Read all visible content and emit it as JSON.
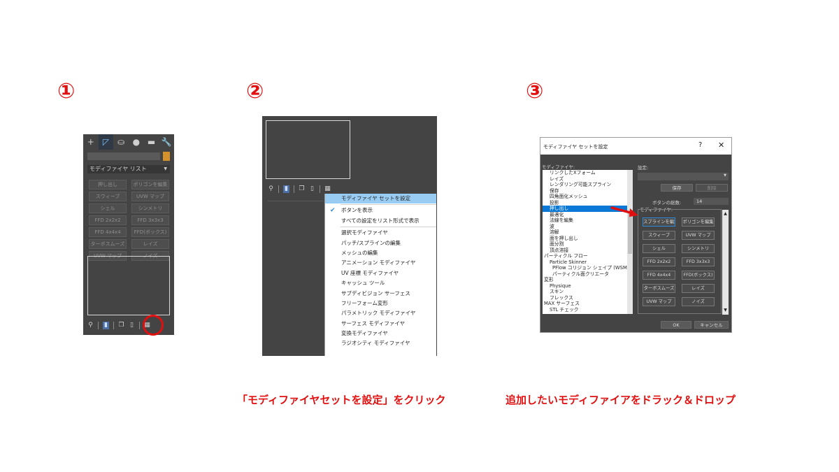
{
  "steps": [
    "①",
    "②",
    "③"
  ],
  "captions": {
    "step2": "「モディファイヤセットを設定」をクリック",
    "step3": "追加したいモディファイアをドラック＆ドロップ"
  },
  "panel1": {
    "tabs": [
      "+",
      "◸",
      "⛀",
      "●",
      "▬",
      "🔧"
    ],
    "dropdown": "モディファイヤ リスト",
    "buttons": [
      "押し出し",
      "ポリゴンを編集",
      "スウィープ",
      "UVW マップ",
      "シェル",
      "シンメトリ",
      "FFD 2x2x2",
      "FFD 3x3x3",
      "FFD 4x4x4",
      "FFD(ボックス)",
      "ターボスムーズ",
      "レイズ",
      "UVW マップ",
      "ノイズ"
    ]
  },
  "context_menu": {
    "items": [
      {
        "label": "モディファイヤ セットを設定",
        "highlight": true
      },
      {
        "label": "ボタンを表示",
        "checked": true
      },
      {
        "label": "すべての設定をリスト形式で表示"
      },
      {
        "label": "選択モディファイヤ"
      },
      {
        "label": "パッチ/スプラインの編集"
      },
      {
        "label": "メッシュの編集"
      },
      {
        "label": "アニメーション モディファイヤ"
      },
      {
        "label": "UV 座標 モディファイヤ"
      },
      {
        "label": "キャッシュ ツール"
      },
      {
        "label": "サブディビジョン サーフェス"
      },
      {
        "label": "フリーフォーム変形"
      },
      {
        "label": "パラメトリック モディファイヤ"
      },
      {
        "label": "サーフェス モディファイヤ"
      },
      {
        "label": "変換モディファイヤ"
      },
      {
        "label": "ラジオシティ モディファイヤ"
      }
    ]
  },
  "dialog": {
    "title": "モディファイヤ セットを設定",
    "help": "?",
    "close": "✕",
    "modifier_label": "モディファイヤ:",
    "set_label": "設定:",
    "save": "保存",
    "delete": "削除",
    "count_label": "ボタンの総数:",
    "count_value": "14",
    "modifiers_label": "モディファイヤ:",
    "list": [
      "リンクしたXフォーム",
      "レイズ",
      "レンダリング可能スプライン",
      "保存",
      "四角面化メッシュ",
      "投影",
      "押し出し",
      "最適化",
      "法線を編集",
      "波",
      "溶解",
      "面を押し出し",
      "面分割",
      "頂点溶接",
      "パーティクル フロー",
      "Particle Skinner",
      "PFlow コリジョン シェイプ (WSM)",
      "パーティクル面クリエータ",
      "変形",
      "Physique",
      "スキン",
      "フレックス",
      "MAX サーフェス",
      "STL チェック"
    ],
    "selected_index": 6,
    "buttons": [
      "スプラインを編集",
      "ポリゴンを編集",
      "スウィープ",
      "UVW マップ",
      "シェル",
      "シンメトリ",
      "FFD 2x2x2",
      "FFD 3x3x3",
      "FFD 4x4x4",
      "FFD(ボックス)",
      "ターボスムーズ",
      "レイズ",
      "UVW マップ",
      "ノイズ"
    ],
    "ok": "OK",
    "cancel": "キャンセル"
  },
  "colors": {
    "accent_red": "#e01010",
    "highlight_blue": "#99ccf3",
    "selection_blue": "#0a78d7"
  }
}
